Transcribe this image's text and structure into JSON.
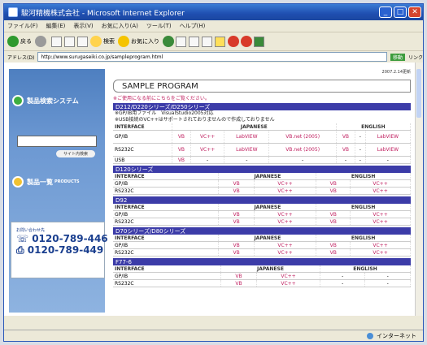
{
  "window": {
    "title": "駿河精機株式会社 - Microsoft Internet Explorer"
  },
  "menu": [
    "ファイル(F)",
    "編集(E)",
    "表示(V)",
    "お気に入り(A)",
    "ツール(T)",
    "ヘルプ(H)"
  ],
  "toolbar": {
    "back": "戻る",
    "search": "検索",
    "favorites": "お気に入り"
  },
  "address": {
    "label": "アドレス(D)",
    "url": "http://www.surugaseiki.co.jp/sampleprogram.html",
    "go": "移動",
    "links": "リンク"
  },
  "status": {
    "zone": "インターネット"
  },
  "sidebar": {
    "product_search": "製品検索システム",
    "site_search": "サイト内検索",
    "product_list": "製品一覧",
    "product_list_sub": "PRODUCTS",
    "contact_label": "お問い合わせ先",
    "tel1": "0120-789-446",
    "fax1": "0120-789-449"
  },
  "page": {
    "date": "2007.2.14更新",
    "title": "SAMPLE PROGRAM",
    "note": "※ご使用になる前にこちらをご覧ください。"
  },
  "sections": [
    {
      "header": "D212/D220シリーズ/D250シリーズ",
      "notes": [
        "※GP/IB用ファイル　VisualStudio2005対応",
        "※USB接続のVC++はサポートされておりませんので作成しておりません"
      ],
      "head": {
        "interface": "INTERFACE",
        "japanese": "JAPANESE",
        "english": "ENGLISH"
      },
      "rows": [
        {
          "name": "GP/IB",
          "cells": [
            "VB",
            "VC++",
            "LabVIEW",
            "VB.net (2005)",
            "VB",
            "-",
            "LabVIEW"
          ],
          "tall": true
        },
        {
          "name": "RS232C",
          "cells": [
            "VB",
            "VC++",
            "LabVIEW",
            "VB.net (2005)",
            "VB",
            "-",
            "LabVIEW"
          ],
          "tall": true
        },
        {
          "name": "USB",
          "cells": [
            "VB",
            "-",
            "-",
            "-",
            "-",
            "-",
            "-"
          ],
          "tall": false
        }
      ]
    },
    {
      "header": "D120シリーズ",
      "head": {
        "interface": "INTERFACE",
        "japanese": "JAPANESE",
        "english": "ENGLISH"
      },
      "rows": [
        {
          "name": "GP/IB",
          "cells": [
            "VB",
            "VC++",
            "VB",
            "VC++"
          ]
        },
        {
          "name": "RS232C",
          "cells": [
            "VB",
            "VC++",
            "VB",
            "VC++"
          ]
        }
      ]
    },
    {
      "header": "D92",
      "head": {
        "interface": "INTERFACE",
        "japanese": "JAPANESE",
        "english": "ENGLISH"
      },
      "rows": [
        {
          "name": "GP/IB",
          "cells": [
            "VB",
            "VC++",
            "VB",
            "VC++"
          ]
        },
        {
          "name": "RS232C",
          "cells": [
            "VB",
            "VC++",
            "VB",
            "VC++"
          ]
        }
      ]
    },
    {
      "header": "D70シリーズ/D80シリーズ",
      "head": {
        "interface": "INTERFACE",
        "japanese": "JAPANESE",
        "english": "ENGLISH"
      },
      "rows": [
        {
          "name": "GP/IB",
          "cells": [
            "VB",
            "VC++",
            "VB",
            "VC++"
          ]
        },
        {
          "name": "RS232C",
          "cells": [
            "VB",
            "VC++",
            "VB",
            "VC++"
          ]
        }
      ]
    },
    {
      "header": "F77-6",
      "head": {
        "interface": "INTERFACE",
        "japanese": "JAPANESE",
        "english": "ENGLISH"
      },
      "rows": [
        {
          "name": "GP/IB",
          "cells": [
            "VB",
            "VC++",
            "-",
            "-"
          ]
        },
        {
          "name": "RS232C",
          "cells": [
            "VB",
            "VC++",
            "-",
            "-"
          ]
        }
      ]
    }
  ]
}
